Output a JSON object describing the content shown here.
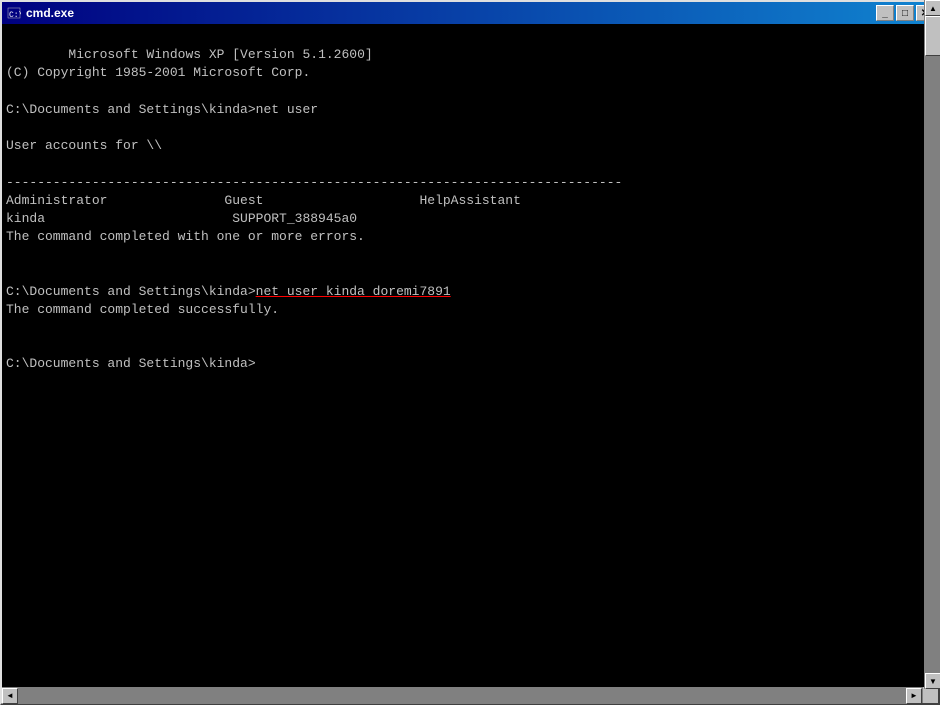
{
  "window": {
    "title": "cmd.exe",
    "title_icon": "terminal-icon"
  },
  "titlebar": {
    "minimize_label": "_",
    "maximize_label": "□",
    "close_label": "✕"
  },
  "console": {
    "line1": "Microsoft Windows XP [Version 5.1.2600]",
    "line2": "(C) Copyright 1985-2001 Microsoft Corp.",
    "line3": "",
    "line4": "C:\\Documents and Settings\\kinda>net user",
    "line5": "",
    "line6": "User accounts for \\\\",
    "line7": "",
    "line8": "-------------------------------------------------------------------------------",
    "line9_col1": "Administrator",
    "line9_col2": "Guest",
    "line9_col3": "HelpAssistant",
    "line10_col1": "kinda",
    "line10_col2": "SUPPORT_388945a0",
    "line11": "The command completed with one or more errors.",
    "line12": "",
    "line13": "",
    "line14_prefix": "C:\\Documents and Settings\\kinda>",
    "line14_cmd": "net user kinda doremi7891",
    "line15": "The command completed successfully.",
    "line16": "",
    "line17": "",
    "line18": "C:\\Documents and Settings\\kinda>"
  },
  "scrollbar": {
    "up_arrow": "▲",
    "down_arrow": "▼",
    "left_arrow": "◄",
    "right_arrow": "►"
  }
}
